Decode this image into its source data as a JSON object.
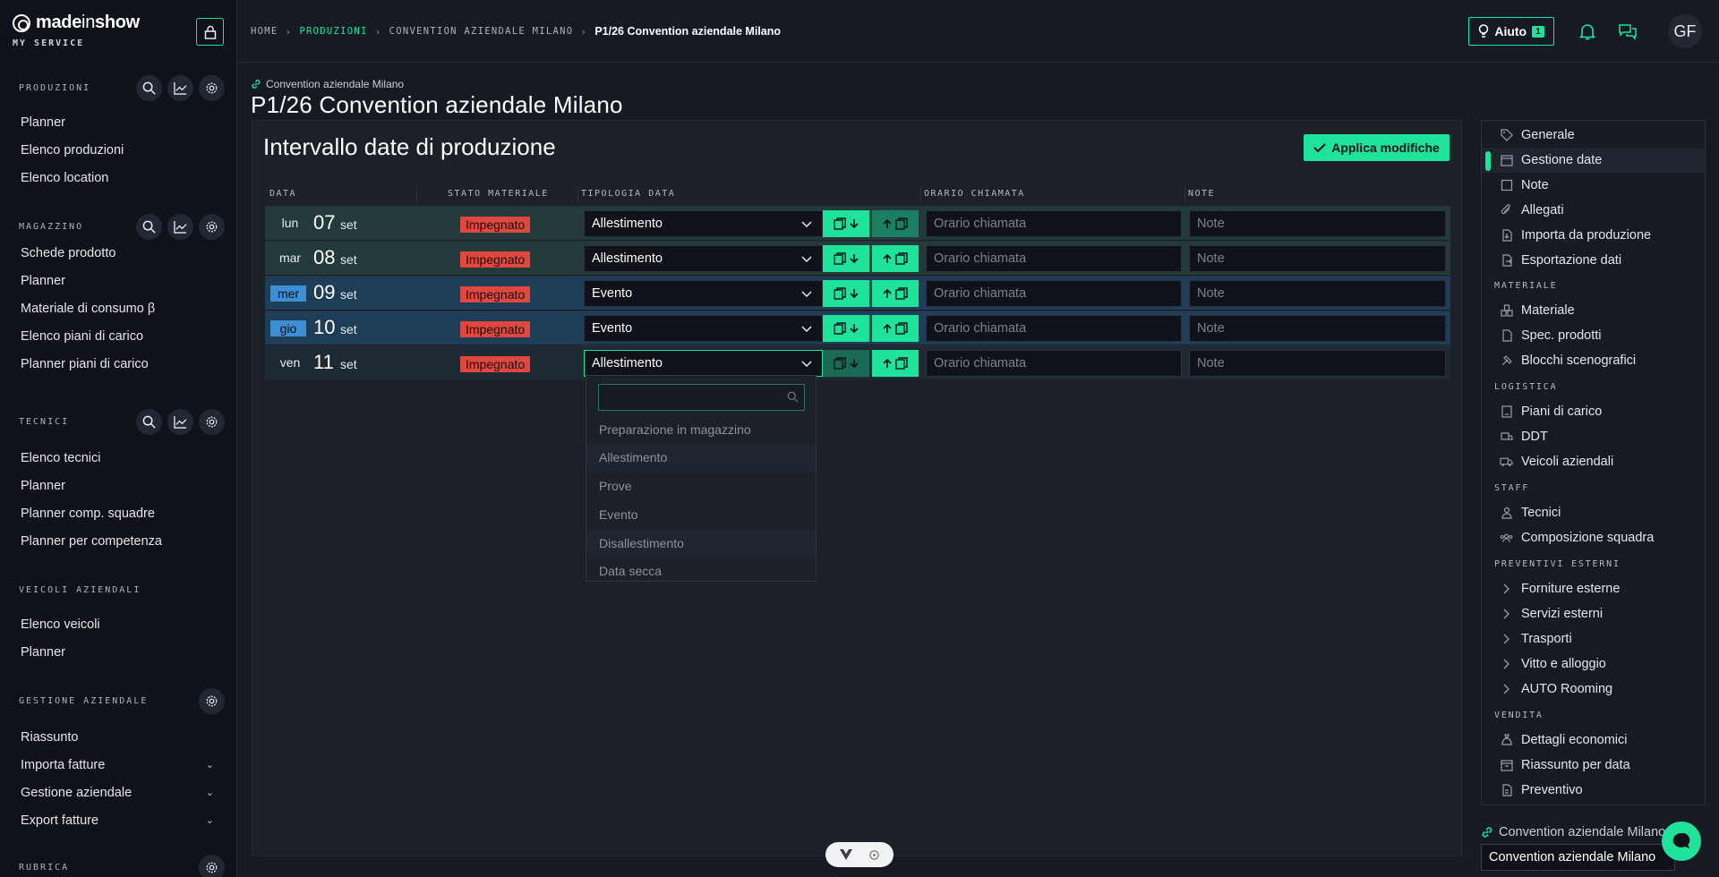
{
  "brand": {
    "name_prefix": "made",
    "name_mid": "in",
    "name_suffix": "show",
    "subtitle": "MY SERVICE"
  },
  "sidebar": {
    "sections": [
      {
        "title": "PRODUZIONI",
        "items": [
          "Planner",
          "Elenco produzioni",
          "Elenco location"
        ]
      },
      {
        "title": "MAGAZZINO",
        "items": [
          "Schede prodotto",
          "Planner",
          "Materiale di consumo β",
          "Elenco piani di carico",
          "Planner piani di carico"
        ]
      },
      {
        "title": "TECNICI",
        "items": [
          "Elenco tecnici",
          "Planner",
          "Planner comp. squadre",
          "Planner per competenza"
        ]
      },
      {
        "title": "VEICOLI AZIENDALI",
        "items": [
          "Elenco veicoli",
          "Planner"
        ]
      },
      {
        "title": "GESTIONE AZIENDALE",
        "items": [
          "Riassunto",
          "Importa fatture",
          "Gestione aziendale",
          "Export fatture"
        ]
      },
      {
        "title": "RUBRICA",
        "items": []
      }
    ]
  },
  "breadcrumb": {
    "home": "HOME",
    "produzioni": "PRODUZIONI",
    "convention": "CONVENTION AZIENDALE MILANO",
    "current": "P1/26 Convention aziendale Milano"
  },
  "topbar": {
    "help_label": "Aiuto",
    "help_count": "1",
    "avatar_initials": "GF"
  },
  "page": {
    "link_label": "Convention aziendale Milano",
    "title": "P1/26 Convention aziendale Milano"
  },
  "panel": {
    "title": "Intervallo date di produzione",
    "apply_label": "Applica modifiche",
    "columns": {
      "data": "DATA",
      "stato": "STATO MATERIALE",
      "tipologia": "TIPOLOGIA DATA",
      "orario": "ORARIO CHIAMATA",
      "note": "NOTE"
    },
    "rows": [
      {
        "day": "lun",
        "num": "07",
        "month": "set",
        "stato": "Impegnato",
        "tipologia": "Allestimento",
        "orario_placeholder": "Orario chiamata",
        "note_placeholder": "Note"
      },
      {
        "day": "mar",
        "num": "08",
        "month": "set",
        "stato": "Impegnato",
        "tipologia": "Allestimento",
        "orario_placeholder": "Orario chiamata",
        "note_placeholder": "Note"
      },
      {
        "day": "mer",
        "num": "09",
        "month": "set",
        "stato": "Impegnato",
        "tipologia": "Evento",
        "orario_placeholder": "Orario chiamata",
        "note_placeholder": "Note"
      },
      {
        "day": "gio",
        "num": "10",
        "month": "set",
        "stato": "Impegnato",
        "tipologia": "Evento",
        "orario_placeholder": "Orario chiamata",
        "note_placeholder": "Note"
      },
      {
        "day": "ven",
        "num": "11",
        "month": "set",
        "stato": "Impegnato",
        "tipologia": "Allestimento",
        "orario_placeholder": "Orario chiamata",
        "note_placeholder": "Note"
      }
    ],
    "dropdown_options": [
      "Preparazione in magazzino",
      "Allestimento",
      "Prove",
      "Evento",
      "Disallestimento",
      "Data secca"
    ]
  },
  "rightnav": {
    "items_top": [
      "Generale",
      "Gestione date",
      "Note",
      "Allegati",
      "Importa da produzione",
      "Esportazione dati"
    ],
    "head_materiale": "MATERIALE",
    "items_materiale": [
      "Materiale",
      "Spec. prodotti",
      "Blocchi scenografici"
    ],
    "head_logistica": "LOGISTICA",
    "items_logistica": [
      "Piani di carico",
      "DDT",
      "Veicoli aziendali"
    ],
    "head_staff": "STAFF",
    "items_staff": [
      "Tecnici",
      "Composizione squadra"
    ],
    "head_preventivi": "PREVENTIVI ESTERNI",
    "items_preventivi": [
      "Forniture esterne",
      "Servizi esterni",
      "Trasporti",
      "Vitto e alloggio",
      "AUTO Rooming"
    ],
    "head_vendita": "VENDITA",
    "items_vendita": [
      "Dettagli economici",
      "Riassunto per data",
      "Preventivo"
    ]
  },
  "footer_right": {
    "link_label": "Convention aziendale Milano",
    "input_value": "Convention aziendale Milano"
  },
  "colors": {
    "accent": "#20e39b",
    "danger": "#e0473f",
    "highlight": "#3e8ed6"
  }
}
